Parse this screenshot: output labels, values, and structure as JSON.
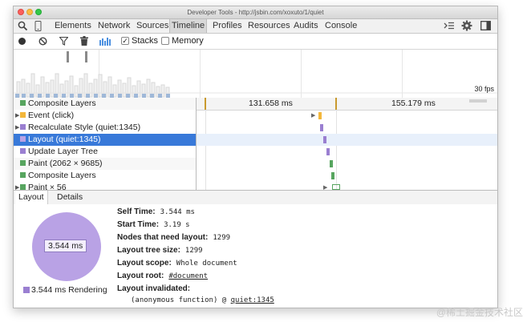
{
  "window_title": "Developer Tools - http://jsbin.com/xoxuto/1/quiet",
  "tabs": [
    "Elements",
    "Network",
    "Sources",
    "Timeline",
    "Profiles",
    "Resources",
    "Audits",
    "Console"
  ],
  "active_tab": "Timeline",
  "toolbar": {
    "stacks_label": "Stacks",
    "memory_label": "Memory",
    "stacks_checked": true,
    "memory_checked": false
  },
  "overview": {
    "fps_label": "30 fps"
  },
  "ruler": {
    "t1": "131.658 ms",
    "t2": "155.179 ms"
  },
  "records": [
    {
      "label": "Composite Layers",
      "color": "#57a55f",
      "expand": ""
    },
    {
      "label": "Event (click)",
      "color": "#f3b73b",
      "expand": "▶"
    },
    {
      "label": "Recalculate Style (quiet:1345)",
      "color": "#9a7fd1",
      "expand": "▶"
    },
    {
      "label": "Layout (quiet:1345)",
      "color": "#9a7fd1",
      "expand": ""
    },
    {
      "label": "Update Layer Tree",
      "color": "#9a7fd1",
      "expand": ""
    },
    {
      "label": "Paint (2062 × 9685)",
      "color": "#57a55f",
      "expand": ""
    },
    {
      "label": "Composite Layers",
      "color": "#57a55f",
      "expand": ""
    },
    {
      "label": "Paint × 56",
      "color": "#57a55f",
      "expand": "▶"
    }
  ],
  "details_tabs": [
    "Layout",
    "Details"
  ],
  "details": {
    "pie_label": "3.544 ms",
    "legend": "3.544 ms Rendering",
    "pie_color": "#b9a2e5",
    "self_time_k": "Self Time:",
    "self_time_v": "3.544 ms",
    "start_time_k": "Start Time:",
    "start_time_v": "3.19 s",
    "nodes_k": "Nodes that need layout:",
    "nodes_v": "1299",
    "tree_k": "Layout tree size:",
    "tree_v": "1299",
    "scope_k": "Layout scope:",
    "scope_v": "Whole document",
    "root_k": "Layout root:",
    "root_v": "#document",
    "invalidated_k": "Layout invalidated:",
    "stack_fn": "(anonymous function) @ ",
    "stack_link": "quiet:1345"
  },
  "watermark": "@稀土掘金技术社区"
}
